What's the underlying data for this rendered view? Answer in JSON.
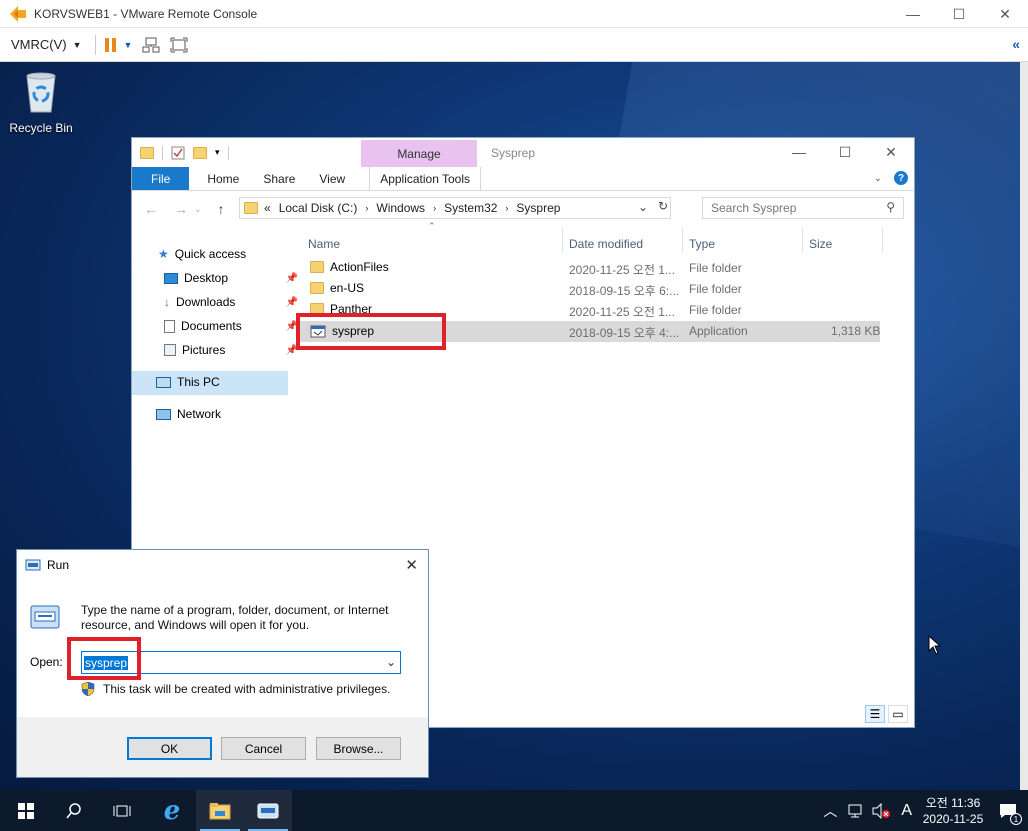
{
  "vmrc": {
    "title": "KORVSWEB1 - VMware Remote Console",
    "menu_label": "VMRC(V)"
  },
  "desktop": {
    "recycle_bin_label": "Recycle Bin"
  },
  "explorer": {
    "title": "Sysprep",
    "manage_tab": "Manage",
    "ribbon_tabs": [
      "File",
      "Home",
      "Share",
      "View",
      "Application Tools"
    ],
    "breadcrumb": [
      "Local Disk (C:)",
      "Windows",
      "System32",
      "Sysprep"
    ],
    "breadcrumb_prefix": "«",
    "search_placeholder": "Search Sysprep",
    "nav": {
      "quick_access": "Quick access",
      "desktop": "Desktop",
      "downloads": "Downloads",
      "documents": "Documents",
      "pictures": "Pictures",
      "this_pc": "This PC",
      "network": "Network"
    },
    "columns": {
      "name": "Name",
      "date": "Date modified",
      "type": "Type",
      "size": "Size"
    },
    "files": [
      {
        "name": "ActionFiles",
        "date": "2020-11-25 오전 1...",
        "type": "File folder",
        "size": ""
      },
      {
        "name": "en-US",
        "date": "2018-09-15 오후 6:...",
        "type": "File folder",
        "size": ""
      },
      {
        "name": "Panther",
        "date": "2020-11-25 오전 1...",
        "type": "File folder",
        "size": ""
      },
      {
        "name": "sysprep",
        "date": "2018-09-15 오후 4:...",
        "type": "Application",
        "size": "1,318 KB"
      }
    ]
  },
  "run": {
    "title": "Run",
    "description": "Type the name of a program, folder, document, or Internet resource, and Windows will open it for you.",
    "open_label": "Open:",
    "input_value": "sysprep",
    "admin_note": "This task will be created with administrative privileges.",
    "ok": "OK",
    "cancel": "Cancel",
    "browse": "Browse..."
  },
  "taskbar": {
    "time": "오전 11:36",
    "date": "2020-11-25",
    "ime": "A",
    "notification_count": "1"
  }
}
